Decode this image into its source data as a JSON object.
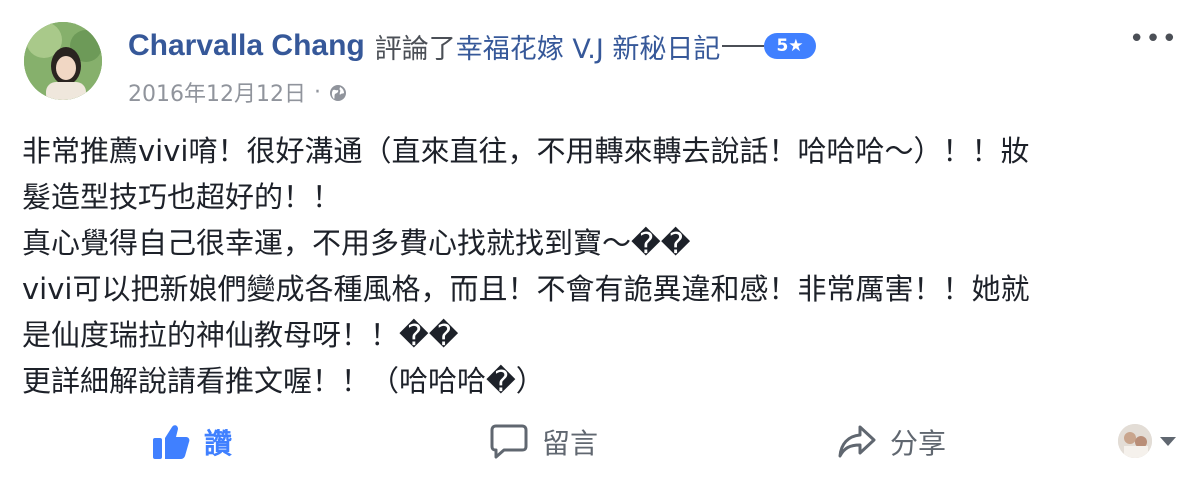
{
  "post": {
    "author": "Charvalla Chang",
    "action": "評論了",
    "page": "幸福花嫁 V.J 新秘日記",
    "rating": "5★",
    "date": "2016年12月12日",
    "separator": "·",
    "more": "•••",
    "lines": [
      "非常推薦vivi唷！很好溝通（直來直往，不用轉來轉去說話！哈哈哈～）！！妝",
      "髮造型技巧也超好的！！",
      "真心覺得自己很幸運，不用多費心找就找到寶～��",
      "vivi可以把新娘們變成各種風格，而且！不會有詭異違和感！非常厲害！！她就",
      "是仙度瑞拉的神仙教母呀！！��",
      "更詳細解說請看推文喔！！（哈哈哈�）"
    ]
  },
  "actions": {
    "like": "讚",
    "comment": "留言",
    "share": "分享"
  },
  "colors": {
    "link": "#365899",
    "accent": "#4080ff",
    "muted": "#90949c"
  },
  "icons": [
    "avatar",
    "globe-icon",
    "like-icon",
    "comment-icon",
    "share-icon",
    "more-icon",
    "chevron-down-icon"
  ]
}
